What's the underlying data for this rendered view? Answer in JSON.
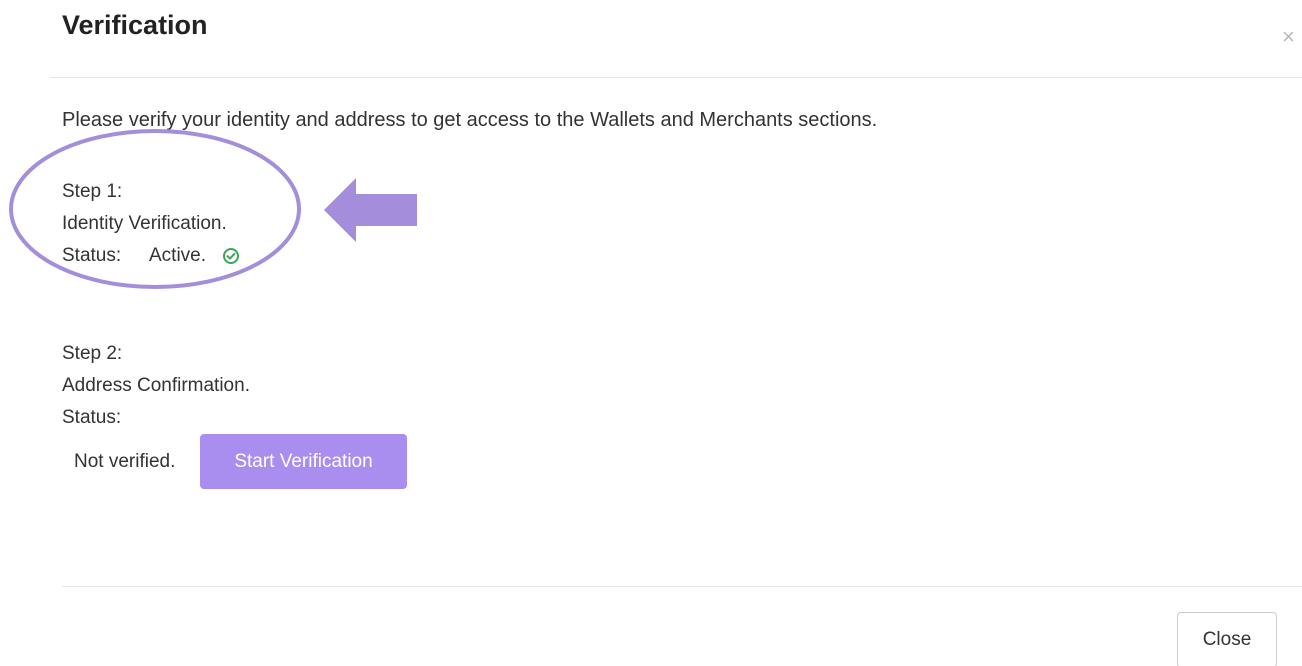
{
  "modal": {
    "title": "Verification",
    "close_x": "×",
    "intro": "Please verify your identity and address to get access to the Wallets and Merchants sections."
  },
  "step1": {
    "label": "Step 1:",
    "name": "Identity Verification.",
    "status_label": "Status:",
    "status_value": "Active.",
    "status_icon": "check-circle-icon",
    "status_color": "#3ca55c"
  },
  "step2": {
    "label": "Step 2:",
    "name": "Address Confirmation.",
    "status_label": "Status:",
    "status_value": "Not verified.",
    "action_label": "Start Verification"
  },
  "footer": {
    "close_label": "Close"
  },
  "colors": {
    "accent": "#a98ef0",
    "annotation": "#a48edc"
  }
}
